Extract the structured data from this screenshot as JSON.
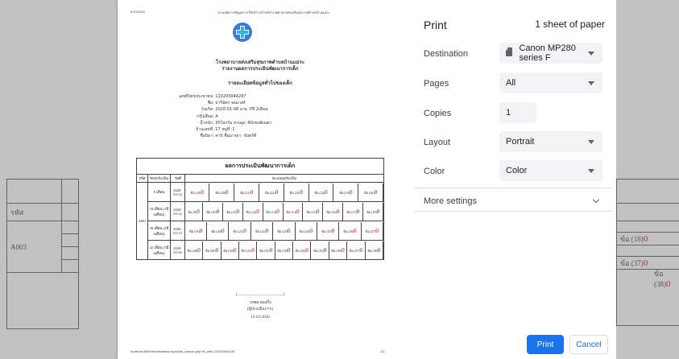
{
  "background": {
    "left": {
      "header_label": "รหัส",
      "code": "A003"
    },
    "right": {
      "cell_top": "ข้อ (18)",
      "cell_bottom_1": "ข้อ (37)",
      "cell_bottom_2": "ข้อ (38)",
      "mark": "0"
    }
  },
  "preview": {
    "header_date": "3/13/2020",
    "header_title": "ระบบจัดการข้อมูลการให้บริการสำหรับโรงพยาบาลส่งเสริมสุขภาพตำบลบ้านแม่ระ",
    "hospital_name": "โรงพยาบาลส่งเสริมสุขภาพตำบลบ้านแม่ระ",
    "report_name": "รายงานผลการประเมินพัฒนาการเด็ก",
    "section_title": "รายละเอียดข้อมูลทั่วไปของเด็ก",
    "info": [
      {
        "k": "เลขที่บัตรประชาชน",
        "v": ": 110203044287"
      },
      {
        "k": "ชื่อ",
        "v": ": ปารีฉัตร จอมวงศ์"
      },
      {
        "k": "วันเกิด",
        "v": ": 2020-01-08 อายุ :0ปี 2เดือน"
      },
      {
        "k": "กรุ๊ปเลือด",
        "v": ": A"
      },
      {
        "k": "น้ำหนัก",
        "v": ": 3กิโลกรัม ส่วนสูง :60เซนติเมตร"
      },
      {
        "k": "บ้านเลขที่",
        "v": ": 17 หมู่ที่ :1"
      },
      {
        "k": "ชื่อบิดา",
        "v": ": ค่าบี ชื่อมารดา :จันทร์ดี"
      }
    ],
    "table": {
      "title": "ผลการประเมินพัฒนาการเด็ก",
      "headers": [
        "รหัส",
        "รอบประเมิน",
        "วันที่",
        "คะแนนประเมิน"
      ],
      "code": "A003",
      "rows": [
        {
          "round": "9 เดือน",
          "date": "2020-03-12",
          "items": [
            "ข้อ (19)",
            "ข้อ (20)",
            "ข้อ (21)",
            "ข้อ (22)",
            "ข้อ (23)",
            "ข้อ (24)",
            "ข้อ (25)",
            "ข้อ (26)"
          ]
        },
        {
          "round": "18 เดือน (1ปี 6เดือน)",
          "date": "2020-03-12",
          "items": [
            "ข้อ (9)",
            "ข้อ (10)",
            "ข้อ (11)",
            "ข้อ (12)",
            "ข้อ (13)",
            "ข้อ (14)",
            "ข้อ (15)",
            "ข้อ (16)",
            "ข้อ (17)",
            "ข้อ (18)"
          ]
        },
        {
          "round": "30 เดือน (2ปี 6เดือน)",
          "date": "2020-03-13",
          "items": [
            "ข้อ (19)",
            "ข้อ (20)",
            "ข้อ (21)",
            "ข้อ (22)",
            "ข้อ (23)",
            "ข้อ (24)",
            "ข้อ (25)",
            "ข้อ (26)",
            "ข้อ (27)"
          ]
        },
        {
          "round": "42 เดือน (3ปี 6เดือน)",
          "date": "2020-03-26",
          "items": [
            "ข้อ (28)",
            "ข้อ (29)",
            "ข้อ (30)",
            "ข้อ (31)",
            "ข้อ (32)",
            "ข้อ (33)",
            "ข้อ (34)",
            "ข้อ (35)",
            "ข้อ (36)",
            "ข้อ (37)",
            "ข้อ (38)"
          ]
        }
      ],
      "mark": "0"
    },
    "sign_line": "(..............................................)",
    "signer_name": "วรพล ทองกึ่ง",
    "signer_role": "(ผู้ประเมินการ)",
    "sign_date": "12-03-2020",
    "footer_url": "localhost:8080/healthstation/syschild_assess.php?id_edit=110203044287",
    "footer_page": "1/1"
  },
  "panel": {
    "title": "Print",
    "sheets": "1 sheet of paper",
    "destination_label": "Destination",
    "destination_value": "Canon MP280 series F",
    "pages_label": "Pages",
    "pages_value": "All",
    "copies_label": "Copies",
    "copies_value": "1",
    "layout_label": "Layout",
    "layout_value": "Portrait",
    "color_label": "Color",
    "color_value": "Color",
    "more_settings": "More settings",
    "print_button": "Print",
    "cancel_button": "Cancel",
    "accent": "#1a73e8"
  }
}
